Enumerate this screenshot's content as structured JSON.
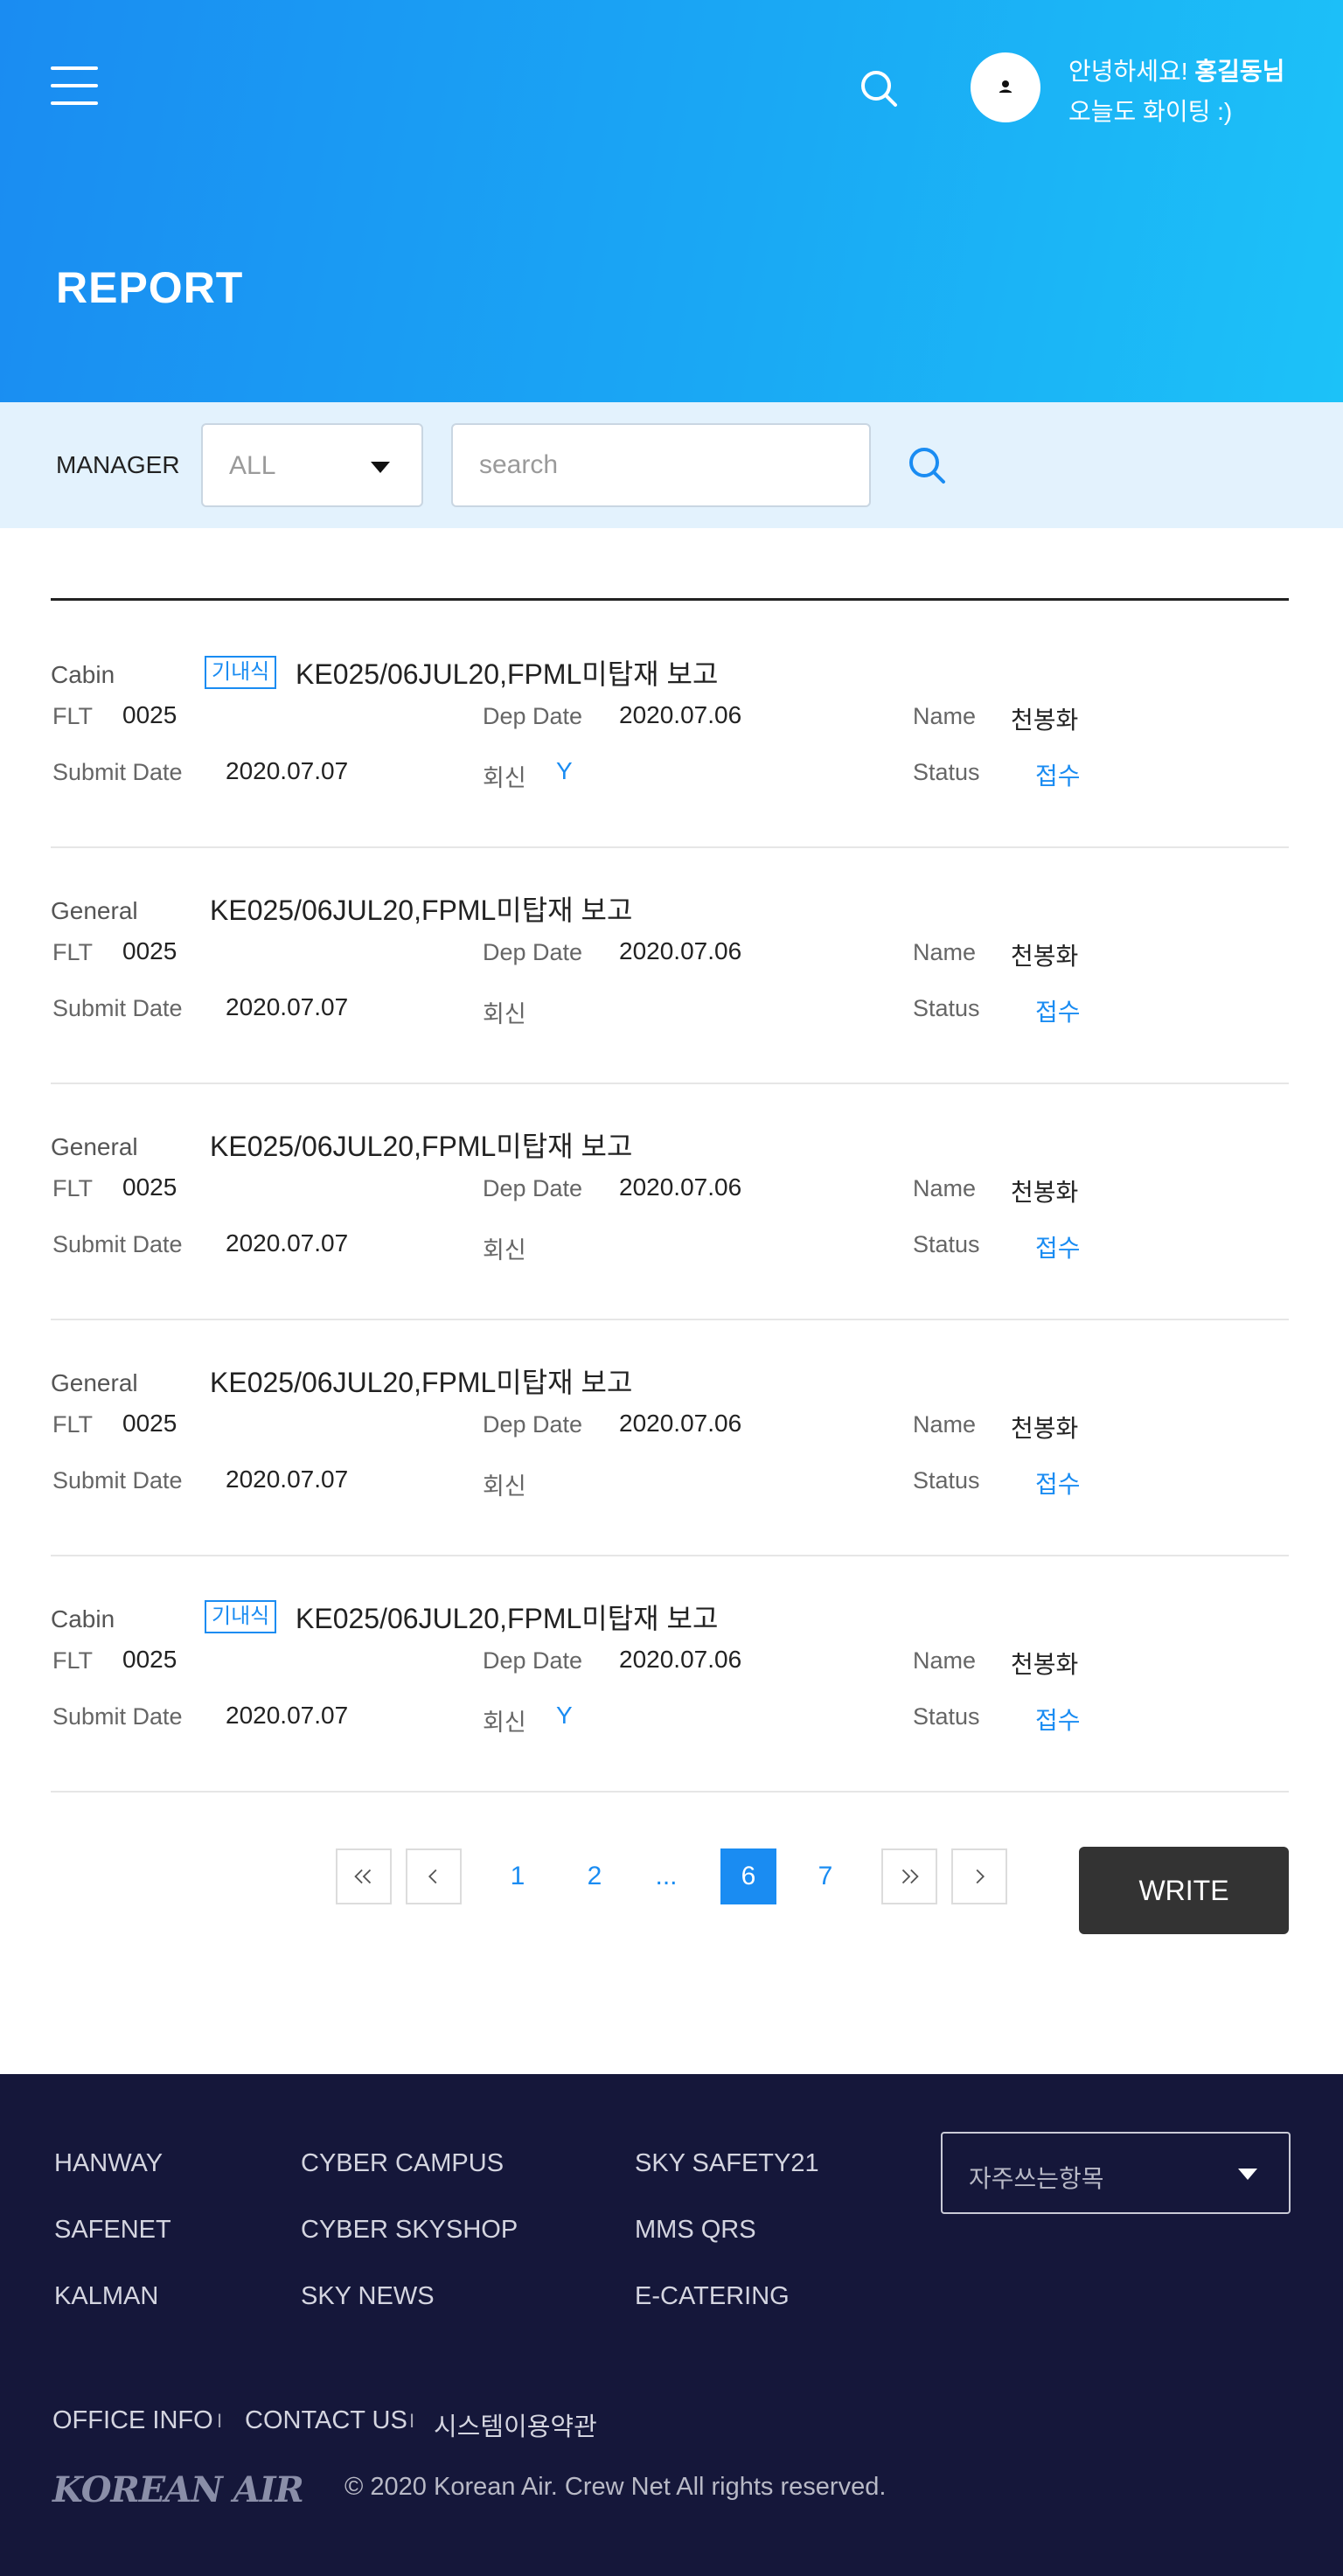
{
  "header": {
    "greeting_prefix": "안녕하세요! ",
    "user_name": "홍길동님",
    "greeting_sub": "오늘도 화이팅 :)",
    "page_title": "REPORT"
  },
  "filter": {
    "manager_label": "MANAGER",
    "manager_selected": "ALL",
    "search_placeholder": "search",
    "search_value": ""
  },
  "labels": {
    "flt": "FLT",
    "dep_date": "Dep Date",
    "name": "Name",
    "submit_date": "Submit Date",
    "reply": "회신",
    "status": "Status"
  },
  "reports": [
    {
      "category": "Cabin",
      "badge": "기내식",
      "title": "KE025/06JUL20,FPML미탑재 보고",
      "flt": "0025",
      "dep_date": "2020.07.06",
      "name": "천봉화",
      "submit_date": "2020.07.07",
      "reply": "Y",
      "status": "접수"
    },
    {
      "category": "General",
      "badge": "",
      "title": "KE025/06JUL20,FPML미탑재 보고",
      "flt": "0025",
      "dep_date": "2020.07.06",
      "name": "천봉화",
      "submit_date": "2020.07.07",
      "reply": "",
      "status": "접수"
    },
    {
      "category": "General",
      "badge": "",
      "title": "KE025/06JUL20,FPML미탑재 보고",
      "flt": "0025",
      "dep_date": "2020.07.06",
      "name": "천봉화",
      "submit_date": "2020.07.07",
      "reply": "",
      "status": "접수"
    },
    {
      "category": "General",
      "badge": "",
      "title": "KE025/06JUL20,FPML미탑재 보고",
      "flt": "0025",
      "dep_date": "2020.07.06",
      "name": "천봉화",
      "submit_date": "2020.07.07",
      "reply": "",
      "status": "접수"
    },
    {
      "category": "Cabin",
      "badge": "기내식",
      "title": "KE025/06JUL20,FPML미탑재 보고",
      "flt": "0025",
      "dep_date": "2020.07.06",
      "name": "천봉화",
      "submit_date": "2020.07.07",
      "reply": "Y",
      "status": "접수"
    }
  ],
  "pagination": {
    "pages": [
      "1",
      "2",
      "...",
      "6",
      "7"
    ],
    "current": "6",
    "write_label": "WRITE"
  },
  "footer": {
    "col1": [
      "HANWAY",
      "SAFENET",
      "KALMAN"
    ],
    "col2": [
      "CYBER CAMPUS",
      "CYBER SKYSHOP",
      "SKY NEWS"
    ],
    "col3": [
      "SKY SAFETY21",
      "MMS QRS",
      "E-CATERING"
    ],
    "favorites_placeholder": "자주쓰는항목",
    "bottom_links": [
      "OFFICE INFO",
      "CONTACT US",
      "시스템이용약관"
    ],
    "separator": "I",
    "logo_text": "KOREAN AIR",
    "copyright": "© 2020 Korean Air. Crew Net  All rights reserved."
  },
  "colors": {
    "accent": "#1a8cf2",
    "header_gradient_start": "#1a8cf2",
    "header_gradient_end": "#1cc2f8",
    "filter_bg": "#e3f2fd",
    "footer_bg": "#15173a",
    "write_button": "#333333"
  },
  "icons": {
    "menu": "hamburger-menu-icon",
    "search": "search-icon",
    "avatar": "user-icon",
    "dropdown": "caret-down-icon",
    "first": "double-chevron-left-icon",
    "prev": "chevron-left-icon",
    "last": "double-chevron-right-icon",
    "next": "chevron-right-icon"
  }
}
